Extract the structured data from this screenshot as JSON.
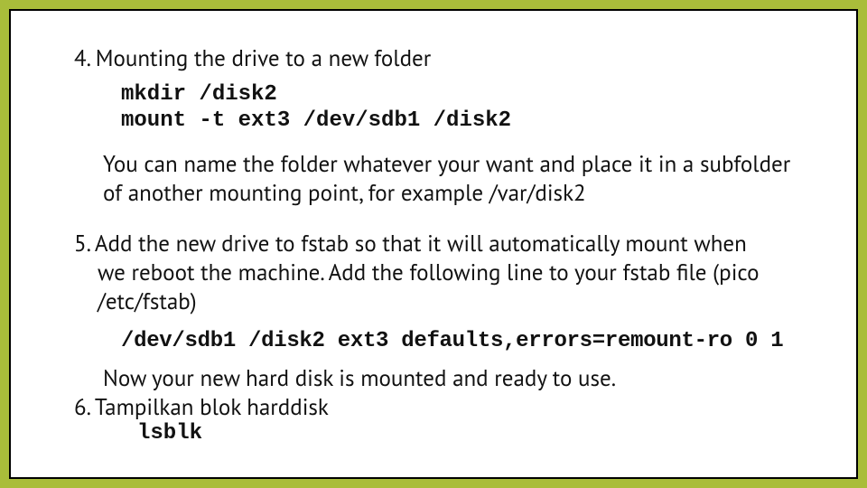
{
  "step4": {
    "heading": "4. Mounting the drive to a new folder",
    "code": "mkdir /disk2\nmount -t ext3 /dev/sdb1 /disk2",
    "note": "You can name the folder whatever your want and place it in a subfolder of another mounting point, for example /var/disk2"
  },
  "step5": {
    "text_first": "5. Add the new drive to fstab so that it will automatically mount when",
    "text_rest": "we reboot the machine. Add the following line to your fstab file (pico /etc/fstab)",
    "code": "/dev/sdb1 /disk2 ext3 defaults,errors=remount-ro 0 1",
    "note": "Now your new hard disk is mounted and ready to use."
  },
  "step6": {
    "heading": "6. Tampilkan blok harddisk",
    "code": "lsblk"
  }
}
